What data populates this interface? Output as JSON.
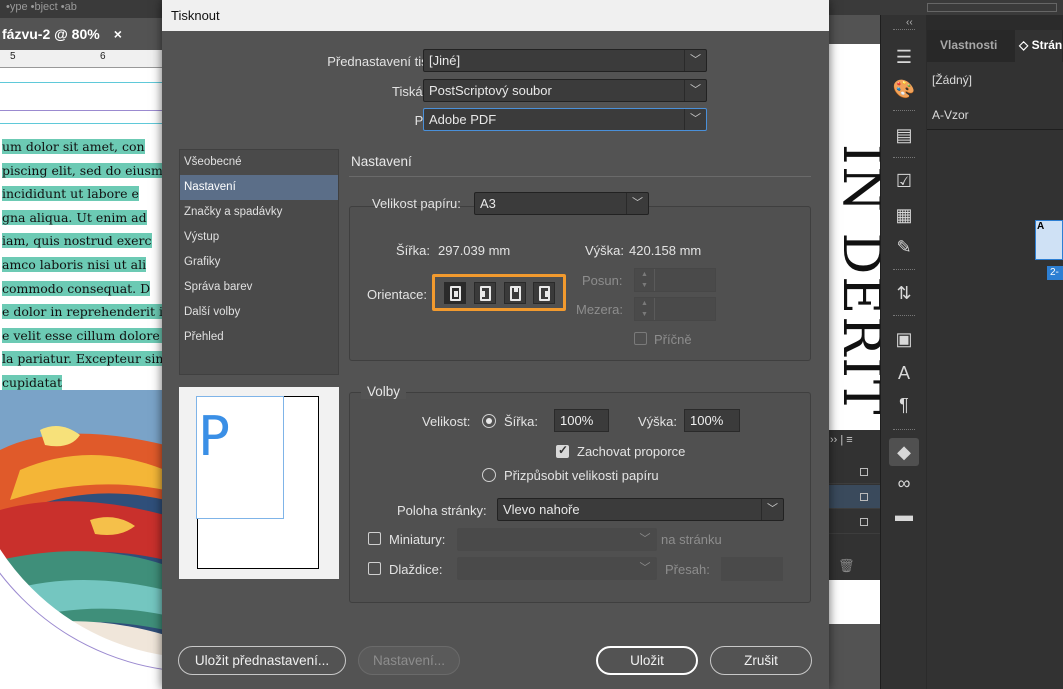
{
  "background": {
    "menubar_text": "•ype  •bject  •ab",
    "doc_tab_title": "fázvu-2 @ 80%",
    "doc_tab_close": "×",
    "ruler_marks": [
      "5",
      "6"
    ],
    "body_text_lines": [
      "um dolor sit amet, con",
      "piscing elit, sed do eiusm",
      " incididunt ut labore e",
      "gna aliqua. Ut enim ad",
      "iam, quis nostrud exerc",
      "amco laboris nisi ut ali",
      "commodo consequat. D",
      "e dolor in reprehenderit i",
      "e velit esse cillum dolore e",
      "la pariatur. Excepteur sin",
      " cupidatat"
    ],
    "vertical_heading": "IN DERIT",
    "right_panel": {
      "tab_properties": "Vlastnosti",
      "tab_pages": "◇ Strán",
      "none_item": "[Žádný]",
      "master_item": "A-Vzor",
      "thumb_letter": "A",
      "page_badge": "2-"
    },
    "collapse_arrows": "‹‹",
    "layers_header": "›› | ≡"
  },
  "dialog": {
    "title": "Tisknout",
    "preset_label": "Přednastavení tisku:",
    "preset_value": "[Jiné]",
    "printer_label": "Tiskárna:",
    "printer_value": "PostScriptový soubor",
    "ppd_label": "PPD:",
    "ppd_value": "Adobe PDF",
    "categories": [
      {
        "label": "Všeobecné",
        "active": false
      },
      {
        "label": "Nastavení",
        "active": true
      },
      {
        "label": "Značky a spadávky",
        "active": false
      },
      {
        "label": "Výstup",
        "active": false
      },
      {
        "label": "Grafiky",
        "active": false
      },
      {
        "label": "Správa barev",
        "active": false
      },
      {
        "label": "Další volby",
        "active": false
      },
      {
        "label": "Přehled",
        "active": false
      }
    ],
    "preview_letter": "P",
    "section_title": "Nastavení",
    "paper": {
      "size_label": "Velikost papíru:",
      "size_value": "A3",
      "width_label": "Šířka:",
      "width_value": "297.039 mm",
      "height_label": "Výška:",
      "height_value": "420.158 mm",
      "orientation_label": "Orientace:",
      "offset_label": "Posun:",
      "gap_label": "Mezera:",
      "transverse_label": "Příčně"
    },
    "options": {
      "group_title": "Volby",
      "scale_label": "Velikost:",
      "scale_width_label": "Šířka:",
      "scale_width_value": "100%",
      "scale_height_label": "Výška:",
      "scale_height_value": "100%",
      "keep_proportions_label": "Zachovat proporce",
      "keep_proportions_checked": true,
      "fit_label": "Přizpůsobit velikosti papíru",
      "page_position_label": "Poloha stránky:",
      "page_position_value": "Vlevo nahoře",
      "thumbnails_label": "Miniatury:",
      "per_page_label": "na stránku",
      "tiles_label": "Dlaždice:",
      "overlap_label": "Přesah:"
    },
    "buttons": {
      "save_preset": "Uložit přednastavení...",
      "setup": "Nastavení...",
      "save": "Uložit",
      "cancel": "Zrušit"
    },
    "colors": {
      "accent_highlight": "#f29a2e",
      "focus_blue": "#4a90d9",
      "text_highlight": "#6ccab4",
      "preview_blue": "#3a8fe6"
    }
  }
}
